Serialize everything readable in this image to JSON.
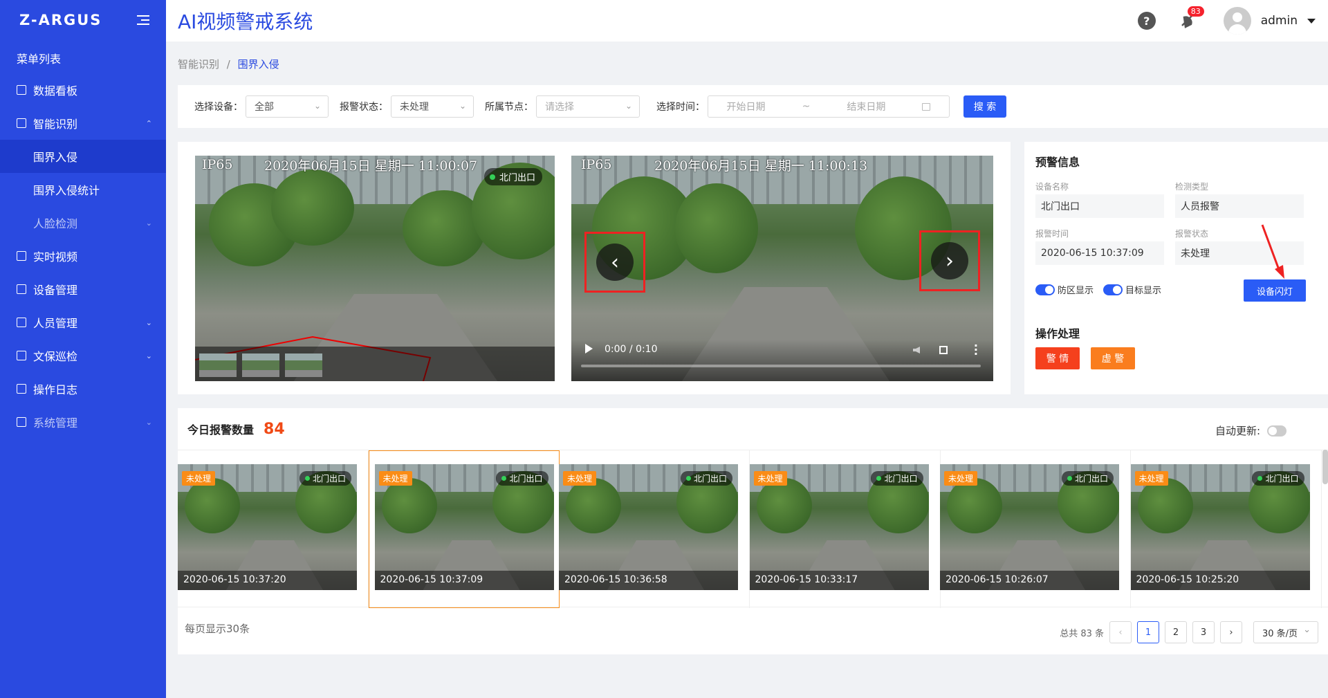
{
  "sidebar": {
    "logo": "Z-ARGUS",
    "menu_title": "菜单列表",
    "items": [
      {
        "label": "数据看板",
        "icon": "chart-icon",
        "level": 1,
        "arrow": ""
      },
      {
        "label": "智能识别",
        "icon": "camera-icon",
        "level": 1,
        "arrow": "⌃"
      },
      {
        "label": "围界入侵",
        "icon": "",
        "level": 2,
        "arrow": "",
        "active": true
      },
      {
        "label": "围界入侵统计",
        "icon": "",
        "level": 2,
        "arrow": ""
      },
      {
        "label": "人脸检测",
        "icon": "",
        "level": 2,
        "arrow": "⌄"
      },
      {
        "label": "实时视频",
        "icon": "video-icon",
        "level": 1,
        "arrow": ""
      },
      {
        "label": "设备管理",
        "icon": "device-icon",
        "level": 1,
        "arrow": ""
      },
      {
        "label": "人员管理",
        "icon": "user-icon",
        "level": 1,
        "arrow": "⌄"
      },
      {
        "label": "文保巡检",
        "icon": "patrol-icon",
        "level": 1,
        "arrow": "⌄"
      },
      {
        "label": "操作日志",
        "icon": "log-icon",
        "level": 1,
        "arrow": ""
      },
      {
        "label": "系统管理",
        "icon": "settings-icon",
        "level": 1,
        "arrow": "⌄"
      }
    ]
  },
  "header": {
    "title": "AI视频警戒系统",
    "help": "?",
    "notification_count": "83",
    "username": "admin"
  },
  "breadcrumb": {
    "parent": "智能识别",
    "sep": "/",
    "current": "围界入侵"
  },
  "filter": {
    "device_label": "选择设备：",
    "device_value": "全部",
    "status_label": "报警状态：",
    "status_value": "未处理",
    "node_label": "所属节点：",
    "node_placeholder": "请选择",
    "time_label": "选择时间：",
    "start_placeholder": "开始日期",
    "range_sep": "~",
    "end_placeholder": "结束日期",
    "search_label": "搜 索"
  },
  "video": {
    "left_osd_model": "IP65",
    "left_osd_time": "2020年06月15日 星期一 11:00:07",
    "right_osd_model": "IP65",
    "right_osd_time": "2020年06月15日 星期一 11:00:13",
    "camera": "北门出口",
    "time_display": "0:00 / 0:10",
    "progress": 0
  },
  "alert": {
    "title": "预警信息",
    "device_name_label": "设备名称",
    "device_name": "北门出口",
    "detect_type_label": "检测类型",
    "detect_type": "人员报警",
    "alarm_time_label": "报警时间",
    "alarm_time": "2020-06-15 10:37:09",
    "alarm_status_label": "报警状态",
    "alarm_status": "未处理",
    "zone_toggle": "防区显示",
    "target_toggle": "目标显示",
    "flash_button": "设备闪灯",
    "op_title": "操作处理",
    "alarm_btn": "警 情",
    "false_btn": "虚 警",
    "colors": {
      "alarm": "#f5401d",
      "false": "#fa7d1e",
      "primary": "#2a5cf6"
    }
  },
  "list": {
    "title": "今日报警数量",
    "count": "84",
    "auto_update": "自动更新:",
    "cards": [
      {
        "status": "未处理",
        "camera": "北门出口",
        "time": "2020-06-15 10:37:20"
      },
      {
        "status": "未处理",
        "camera": "北门出口",
        "time": "2020-06-15 10:37:09"
      },
      {
        "status": "未处理",
        "camera": "北门出口",
        "time": "2020-06-15 10:36:58"
      },
      {
        "status": "未处理",
        "camera": "北门出口",
        "time": "2020-06-15 10:33:17"
      },
      {
        "status": "未处理",
        "camera": "北门出口",
        "time": "2020-06-15 10:26:07"
      },
      {
        "status": "未处理",
        "camera": "北门出口",
        "time": "2020-06-15 10:25:20"
      }
    ],
    "per_page_text": "每页显示30条",
    "total": "总共 83 条",
    "pages": [
      "1",
      "2",
      "3"
    ],
    "page_size": "30 条/页"
  }
}
